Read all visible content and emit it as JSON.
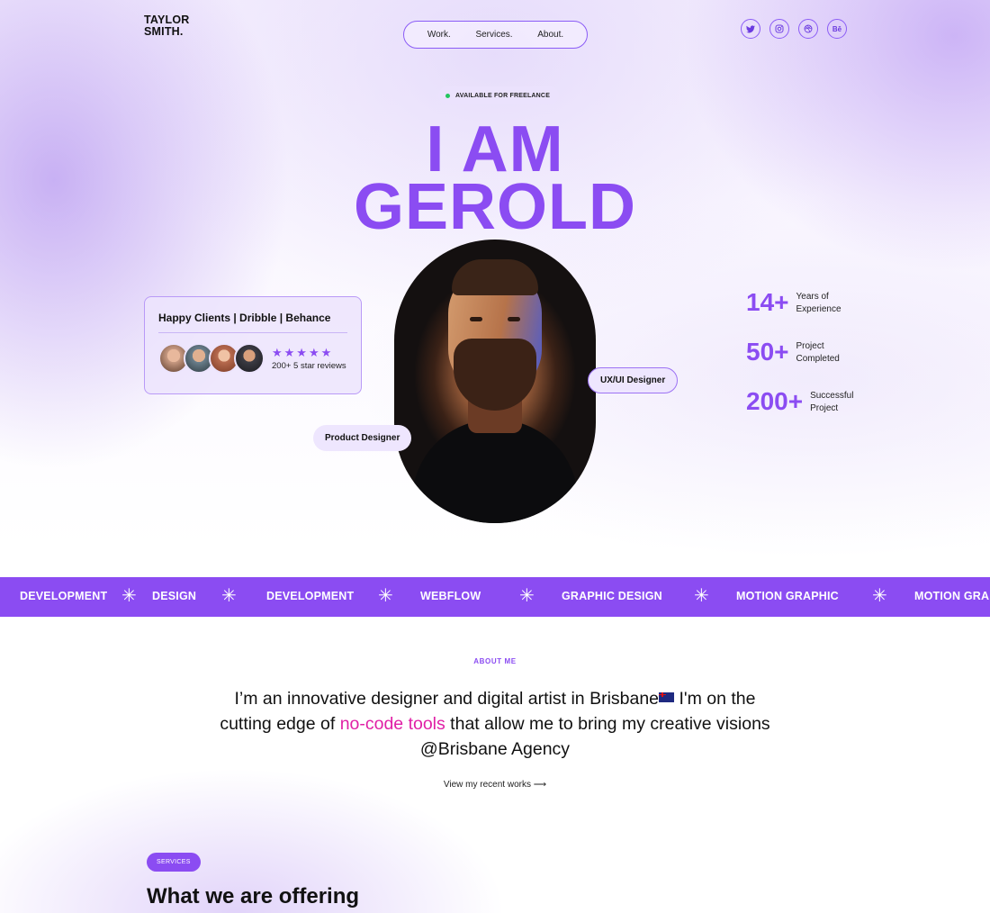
{
  "header": {
    "logo": "TAYLOR\nSMITH.",
    "nav": [
      "Work.",
      "Services.",
      "About."
    ],
    "socials": [
      {
        "icon": "twitter-icon",
        "glyph": "🐦"
      },
      {
        "icon": "instagram-icon",
        "glyph": "◎"
      },
      {
        "icon": "dribbble-icon",
        "glyph": "⊛"
      },
      {
        "icon": "behance-icon",
        "glyph": "Bē"
      }
    ]
  },
  "hero": {
    "badge": "AVAILABLE FOR FREELANCE",
    "title_line1": "I AM",
    "title_line2": "GEROLD",
    "clients_card": {
      "title": "Happy Clients | Dribble | Behance",
      "stars": "★★★★★",
      "reviews": "200+ 5 star reviews",
      "avatar_colors": [
        "#c89a82",
        "#6b7f8c",
        "#b86b4f",
        "#3c3c44"
      ]
    },
    "pill_ux": "UX/UI Designer",
    "pill_product": "Product Designer",
    "stats": [
      {
        "num": "14+",
        "label": "Years of\nExperience"
      },
      {
        "num": "50+",
        "label": "Project\nCompleted"
      },
      {
        "num": "200+",
        "label": "Successful\nProject"
      }
    ]
  },
  "marquee": {
    "items": [
      "DEVELOPMENT",
      "DESIGN",
      "DEVELOPMENT",
      "WEBFLOW",
      "GRAPHIC DESIGN",
      "MOTION GRAPHIC",
      "MOTION GRA"
    ],
    "separator": "✳"
  },
  "about": {
    "label": "ABOUT ME",
    "text_part1": "I’m an innovative designer and digital artist in Brisbane",
    "text_part2": " I'm on the cutting edge of ",
    "highlight": "no-code tools",
    "text_part3": " that allow me to bring my creative visions @Brisbane Agency",
    "link": "View my recent works  ⟶"
  },
  "services": {
    "badge": "SERVICES",
    "title": "What we are offering"
  }
}
